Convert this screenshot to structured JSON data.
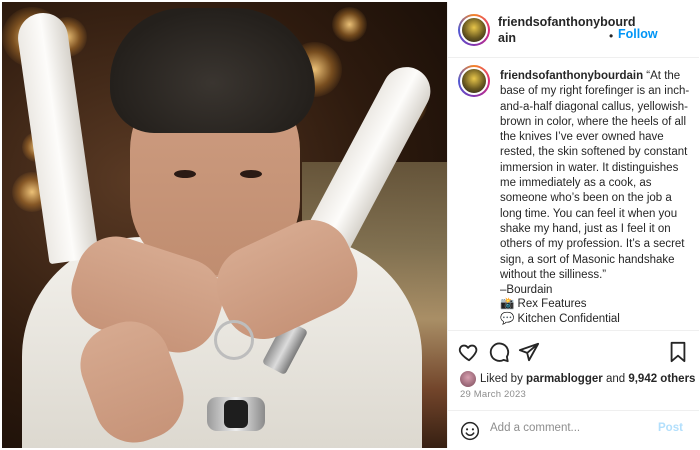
{
  "post": {
    "account": "friendsofanthonybourdain",
    "account_line1": "friendsofanthonybourd",
    "account_line2": "ain",
    "follow_separator": "•",
    "follow_label": "Follow",
    "more_icon": "more-horizontal-icon",
    "caption_username": "friendsofanthonybourdain",
    "caption_text": " “At the base of my right forefinger is an inch-and-a-half diagonal callus, yellowish-brown in color, where the heels of all the knives I’ve ever owned have rested, the skin softened by constant immersion in water. It distinguishes me immediately as a cook, as someone who’s been on the job a long time. You can feel it when you shake my hand, just as I feel it on others of my profession. It’s a secret sign, a sort of Masonic handshake without the silliness.”\n–Bourdain",
    "credits": [
      {
        "emoji": "📸",
        "text": "Rex Features"
      },
      {
        "emoji": "💬",
        "text": "Kitchen Confidential"
      }
    ],
    "likes": {
      "prefix": "Liked by",
      "user": "parmablogger",
      "middle": "and",
      "count": "9,942 others"
    },
    "date": "29 March 2023",
    "comment": {
      "placeholder": "Add a comment...",
      "post_label": "Post"
    }
  },
  "icons": {
    "like": "heart-icon",
    "comment": "comment-bubble-icon",
    "share": "paper-plane-icon",
    "save": "bookmark-icon",
    "emoji": "smiley-icon"
  },
  "colors": {
    "follow": "#0095f6",
    "post_disabled": "#b2dffc",
    "meta_text": "#8e8e8e"
  }
}
